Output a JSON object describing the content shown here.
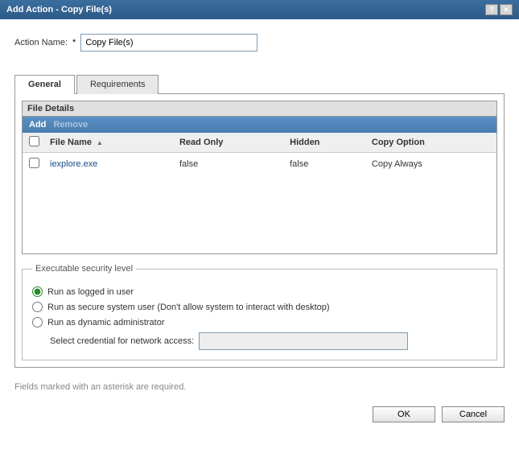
{
  "title": "Add Action - Copy File(s)",
  "actionName": {
    "label": "Action Name:",
    "required": "*",
    "value": "Copy File(s)"
  },
  "tabs": {
    "general": "General",
    "requirements": "Requirements"
  },
  "fileDetails": {
    "title": "File Details",
    "toolbar": {
      "add": "Add",
      "remove": "Remove"
    },
    "columns": {
      "fileName": "File Name",
      "readOnly": "Read Only",
      "hidden": "Hidden",
      "copyOption": "Copy Option"
    },
    "rows": [
      {
        "fileName": "iexplore.exe",
        "readOnly": "false",
        "hidden": "false",
        "copyOption": "Copy Always"
      }
    ]
  },
  "security": {
    "legend": "Executable security level",
    "opt1": "Run as logged in user",
    "opt2": "Run as secure system user (Don't allow system to interact with desktop)",
    "opt3": "Run as dynamic administrator",
    "credLabel": "Select credential for network access:",
    "credValue": ""
  },
  "footerNote": "Fields marked with an asterisk are required.",
  "buttons": {
    "ok": "OK",
    "cancel": "Cancel"
  },
  "icons": {
    "help": "?",
    "close": "✕",
    "sortAsc": "▲"
  }
}
